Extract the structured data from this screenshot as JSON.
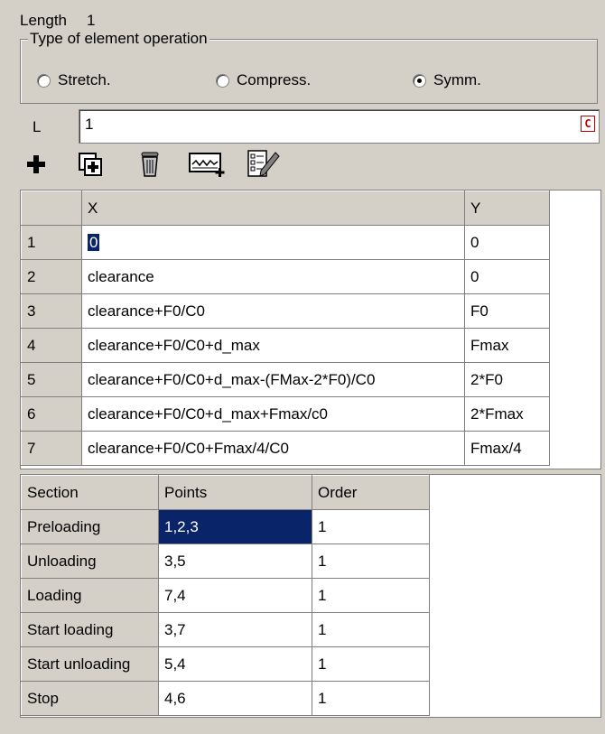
{
  "length": {
    "label": "Length",
    "value": "1"
  },
  "operation_group": {
    "title": "Type of element operation",
    "options": [
      {
        "label": "Stretch.",
        "checked": false
      },
      {
        "label": "Compress.",
        "checked": false
      },
      {
        "label": "Symm.",
        "checked": true
      }
    ]
  },
  "l_field": {
    "label": "L",
    "value": "1",
    "c_button": "C"
  },
  "toolbar": {
    "icons": [
      "add-icon",
      "duplicate-icon",
      "delete-icon",
      "graph-icon",
      "edit-list-icon"
    ]
  },
  "points_table": {
    "columns": [
      "X",
      "Y"
    ],
    "rows": [
      {
        "n": "1",
        "x": "0",
        "y": "0"
      },
      {
        "n": "2",
        "x": "clearance",
        "y": "0"
      },
      {
        "n": "3",
        "x": "clearance+F0/C0",
        "y": "F0"
      },
      {
        "n": "4",
        "x": "clearance+F0/C0+d_max",
        "y": "Fmax"
      },
      {
        "n": "5",
        "x": "clearance+F0/C0+d_max-(FMax-2*F0)/C0",
        "y": "2*F0"
      },
      {
        "n": "6",
        "x": "clearance+F0/C0+d_max+Fmax/c0",
        "y": "2*Fmax"
      },
      {
        "n": "7",
        "x": "clearance+F0/C0+Fmax/4/C0",
        "y": "Fmax/4"
      }
    ]
  },
  "sections_table": {
    "columns": [
      "Section",
      "Points",
      "Order"
    ],
    "rows": [
      {
        "section": "Preloading",
        "points": "1,2,3",
        "order": "1"
      },
      {
        "section": "Unloading",
        "points": "3,5",
        "order": "1"
      },
      {
        "section": "Loading",
        "points": "7,4",
        "order": "1"
      },
      {
        "section": "Start loading",
        "points": "3,7",
        "order": "1"
      },
      {
        "section": "Start unloading",
        "points": "5,4",
        "order": "1"
      },
      {
        "section": "Stop",
        "points": "4,6",
        "order": "1"
      }
    ]
  },
  "colors": {
    "face": "#d4d0c8",
    "selection": "#0a246a",
    "accent_red": "#c00000"
  }
}
